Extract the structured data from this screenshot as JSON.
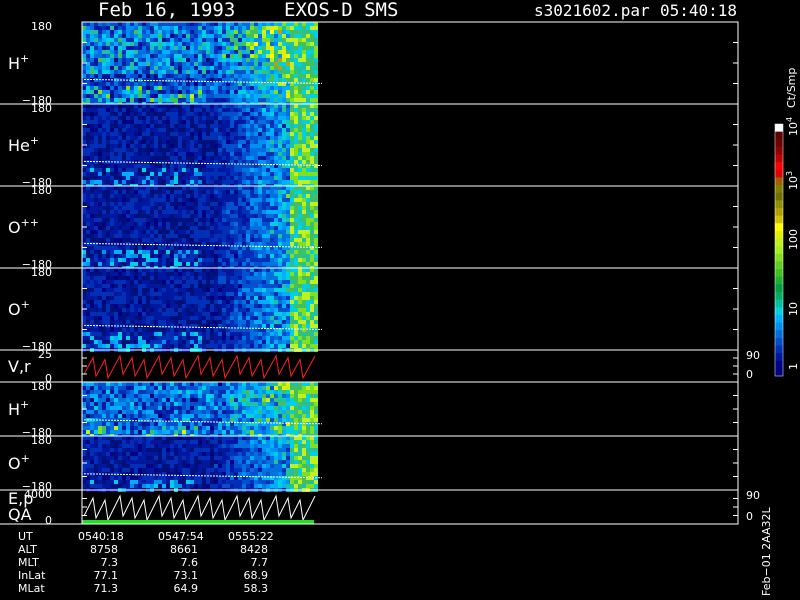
{
  "header": {
    "date": "Feb 16, 1993",
    "mission": "EXOS-D SMS",
    "filename": "s3021602.par",
    "time": "05:40:18"
  },
  "panels": [
    {
      "label": "H",
      "sup": "+",
      "top": "180",
      "bottom": "−180"
    },
    {
      "label": "He",
      "sup": "+",
      "top": "180",
      "bottom": "−180"
    },
    {
      "label": "O",
      "sup": "++",
      "top": "180",
      "bottom": "−180"
    },
    {
      "label": "O",
      "sup": "+",
      "top": "180",
      "bottom": "−180"
    },
    {
      "label": "V,r",
      "sup": "",
      "top": "25",
      "bottom": "0",
      "right_top": "90",
      "right_bottom": "0"
    },
    {
      "label": "H",
      "sup": "+",
      "top": "180",
      "bottom": "−180"
    },
    {
      "label": "O",
      "sup": "+",
      "top": "180",
      "bottom": "−180"
    },
    {
      "label": "E,p",
      "sup": "",
      "label2": "QA",
      "top": "4000",
      "bottom": "0",
      "right_top": "90",
      "right_bottom": "0"
    }
  ],
  "colorbar": {
    "unit": "Ct/Smp",
    "ticks": [
      "1",
      "10",
      "100",
      "10",
      "10"
    ],
    "tick_exps": [
      "",
      "",
      "",
      "3",
      "4"
    ],
    "colors": [
      "#000080",
      "#00008c",
      "#0018a0",
      "#0030b8",
      "#0050d0",
      "#0070e0",
      "#0090f0",
      "#00b0ff",
      "#00d0e0",
      "#00c0a0",
      "#00b060",
      "#00a040",
      "#20b030",
      "#40c020",
      "#60d020",
      "#80e020",
      "#a0f020",
      "#c0f020",
      "#e0f000",
      "#ffff00",
      "#d0c000",
      "#b0a000",
      "#909000",
      "#707000",
      "#808000",
      "#a06000",
      "#e00000",
      "#ff0000",
      "#c00000",
      "#900000",
      "#700000",
      "#600000",
      "#ffffff"
    ]
  },
  "side_text": "Feb−01 2AA32L",
  "info": {
    "rows": [
      {
        "label": "UT",
        "v1": "0540:18",
        "v2": "0547:54",
        "v3": "0555:22"
      },
      {
        "label": "ALT",
        "v1": "8758",
        "v2": "8661",
        "v3": "8428"
      },
      {
        "label": "MLT",
        "v1": "7.3",
        "v2": "7.6",
        "v3": "7.7"
      },
      {
        "label": "InLat",
        "v1": "77.1",
        "v2": "73.1",
        "v3": "68.9"
      },
      {
        "label": "MLat",
        "v1": "71.3",
        "v2": "64.9",
        "v3": "58.3"
      }
    ]
  },
  "chart_data": {
    "type": "heatmap",
    "title": "Feb 16, 1993   EXOS-D SMS",
    "xlabel": "UT",
    "x_ticks": [
      "0540:18",
      "0547:54",
      "0555:22"
    ],
    "colorscale": "log",
    "color_range": [
      1,
      10000
    ],
    "series": [
      {
        "name": "H+",
        "ylim": [
          -180,
          180
        ]
      },
      {
        "name": "He+",
        "ylim": [
          -180,
          180
        ]
      },
      {
        "name": "O++",
        "ylim": [
          -180,
          180
        ]
      },
      {
        "name": "O+",
        "ylim": [
          -180,
          180
        ]
      },
      {
        "name": "V,r",
        "ylim": [
          0,
          25
        ],
        "y2lim": [
          0,
          90
        ]
      },
      {
        "name": "H+",
        "ylim": [
          -180,
          180
        ]
      },
      {
        "name": "O+",
        "ylim": [
          -180,
          180
        ]
      },
      {
        "name": "E,p",
        "ylim": [
          0,
          4000
        ],
        "y2lim": [
          0,
          90
        ]
      }
    ]
  }
}
